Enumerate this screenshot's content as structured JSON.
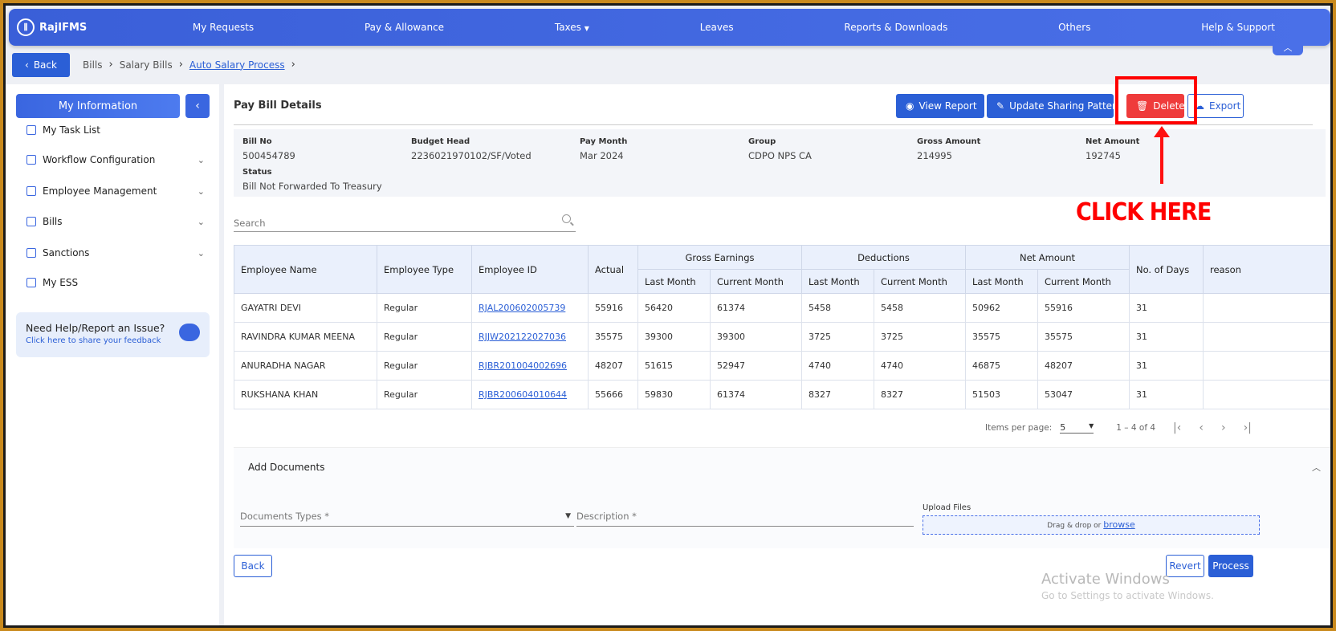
{
  "app": {
    "logo": "RajIFMS"
  },
  "nav": {
    "items": [
      "My Requests",
      "Pay & Allowance",
      "Taxes",
      "Leaves",
      "Reports & Downloads",
      "Others",
      "Help & Support"
    ]
  },
  "breadcrumb": {
    "back": "Back",
    "items": [
      "Bills",
      "Salary Bills",
      "Auto Salary Process"
    ]
  },
  "sidebar": {
    "header": "My Information",
    "items": [
      "My Task List",
      "Workflow Configuration",
      "Employee Management",
      "Bills",
      "Sanctions",
      "My ESS"
    ],
    "help_title": "Need Help/Report an Issue?",
    "help_link": "Click here to share your feedback"
  },
  "page": {
    "title": "Pay Bill Details",
    "buttons": {
      "view_report": "View Report",
      "update_sharing": "Update Sharing Pattern",
      "delete": "Delete",
      "export": "Export"
    }
  },
  "details": {
    "bill_no_label": "Bill No",
    "bill_no": "500454789",
    "budget_head_label": "Budget Head",
    "budget_head": "2236021970102/SF/Voted",
    "pay_month_label": "Pay Month",
    "pay_month": "Mar 2024",
    "group_label": "Group",
    "group": "CDPO NPS CA",
    "gross_amount_label": "Gross Amount",
    "gross_amount": "214995",
    "net_amount_label": "Net Amount",
    "net_amount": "192745",
    "status_label": "Status",
    "status": "Bill Not Forwarded To Treasury"
  },
  "search": {
    "placeholder": "Search"
  },
  "table": {
    "headers": {
      "name": "Employee Name",
      "type": "Employee Type",
      "id": "Employee ID",
      "actual": "Actual",
      "gross": "Gross Earnings",
      "deductions": "Deductions",
      "net": "Net Amount",
      "days": "No. of Days",
      "reason": "reason",
      "last": "Last Month",
      "current": "Current Month"
    },
    "rows": [
      {
        "name": "GAYATRI DEVI",
        "type": "Regular",
        "id": "RJAL200602005739",
        "actual": "55916",
        "g_last": "56420",
        "g_cur": "61374",
        "d_last": "5458",
        "d_cur": "5458",
        "n_last": "50962",
        "n_cur": "55916",
        "days": "31"
      },
      {
        "name": "RAVINDRA KUMAR MEENA",
        "type": "Regular",
        "id": "RJJW202122027036",
        "actual": "35575",
        "g_last": "39300",
        "g_cur": "39300",
        "d_last": "3725",
        "d_cur": "3725",
        "n_last": "35575",
        "n_cur": "35575",
        "days": "31"
      },
      {
        "name": "ANURADHA NAGAR",
        "type": "Regular",
        "id": "RJBR201004002696",
        "actual": "48207",
        "g_last": "51615",
        "g_cur": "52947",
        "d_last": "4740",
        "d_cur": "4740",
        "n_last": "46875",
        "n_cur": "48207",
        "days": "31"
      },
      {
        "name": "RUKSHANA KHAN",
        "type": "Regular",
        "id": "RJBR200604010644",
        "actual": "55666",
        "g_last": "59830",
        "g_cur": "61374",
        "d_last": "8327",
        "d_cur": "8327",
        "n_last": "51503",
        "n_cur": "53047",
        "days": "31"
      }
    ]
  },
  "pager": {
    "label": "Items per page:",
    "size": "5",
    "range": "1 – 4 of 4"
  },
  "documents": {
    "title": "Add Documents",
    "types_placeholder": "Documents Types *",
    "description_placeholder": "Description *",
    "upload_label": "Upload Files",
    "drop_text": "Drag & drop or",
    "browse": "browse"
  },
  "footer": {
    "back": "Back",
    "revert": "Revert",
    "process": "Process"
  },
  "annotation": {
    "text": "CLICK HERE",
    "color": "#ff0000"
  },
  "watermark": {
    "line1": "Activate Windows",
    "line2": "Go to Settings to activate Windows."
  }
}
